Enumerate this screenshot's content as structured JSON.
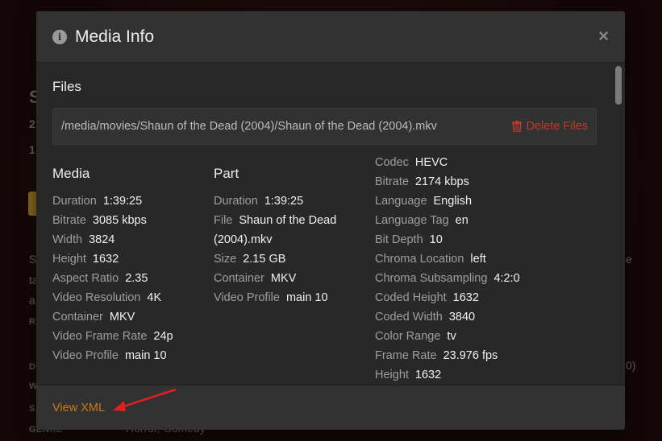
{
  "background": {
    "fragments": [
      "S",
      "2",
      "1",
      "S",
      "ta",
      "a",
      "R",
      "D",
      "W",
      "S",
      "GENRE",
      "Horror, Comedy",
      "e",
      "0)"
    ]
  },
  "modal": {
    "title": "Media Info",
    "close_label": "×",
    "files_heading": "Files",
    "file_path": "/media/movies/Shaun of the Dead (2004)/Shaun of the Dead (2004).mkv",
    "delete_label": "Delete Files",
    "media": {
      "title": "Media",
      "rows": [
        {
          "label": "Duration",
          "value": "1:39:25"
        },
        {
          "label": "Bitrate",
          "value": "3085 kbps"
        },
        {
          "label": "Width",
          "value": "3824"
        },
        {
          "label": "Height",
          "value": "1632"
        },
        {
          "label": "Aspect Ratio",
          "value": "2.35"
        },
        {
          "label": "Video Resolution",
          "value": "4K"
        },
        {
          "label": "Container",
          "value": "MKV"
        },
        {
          "label": "Video Frame Rate",
          "value": "24p"
        },
        {
          "label": "Video Profile",
          "value": "main 10"
        }
      ]
    },
    "part": {
      "title": "Part",
      "duration_label": "Duration",
      "duration_value": "1:39:25",
      "file_label": "File",
      "file_value_line1": "Shaun of the Dead",
      "file_value_line2": "(2004).mkv",
      "size_label": "Size",
      "size_value": "2.15 GB",
      "container_label": "Container",
      "container_value": "MKV",
      "profile_label": "Video Profile",
      "profile_value": "main 10"
    },
    "stream": {
      "rows": [
        {
          "label": "Codec",
          "value": "HEVC"
        },
        {
          "label": "Bitrate",
          "value": "2174 kbps"
        },
        {
          "label": "Language",
          "value": "English"
        },
        {
          "label": "Language Tag",
          "value": "en"
        },
        {
          "label": "Bit Depth",
          "value": "10"
        },
        {
          "label": "Chroma Location",
          "value": "left"
        },
        {
          "label": "Chroma Subsampling",
          "value": "4:2:0"
        },
        {
          "label": "Coded Height",
          "value": "1632"
        },
        {
          "label": "Coded Width",
          "value": "3840"
        },
        {
          "label": "Color Range",
          "value": "tv"
        },
        {
          "label": "Frame Rate",
          "value": "23.976 fps"
        },
        {
          "label": "Height",
          "value": "1632"
        }
      ]
    },
    "footer": {
      "view_xml_label": "View XML"
    }
  },
  "colors": {
    "accent": "#cc7b19",
    "danger": "#c0392b",
    "annotation_arrow": "#e02020"
  }
}
